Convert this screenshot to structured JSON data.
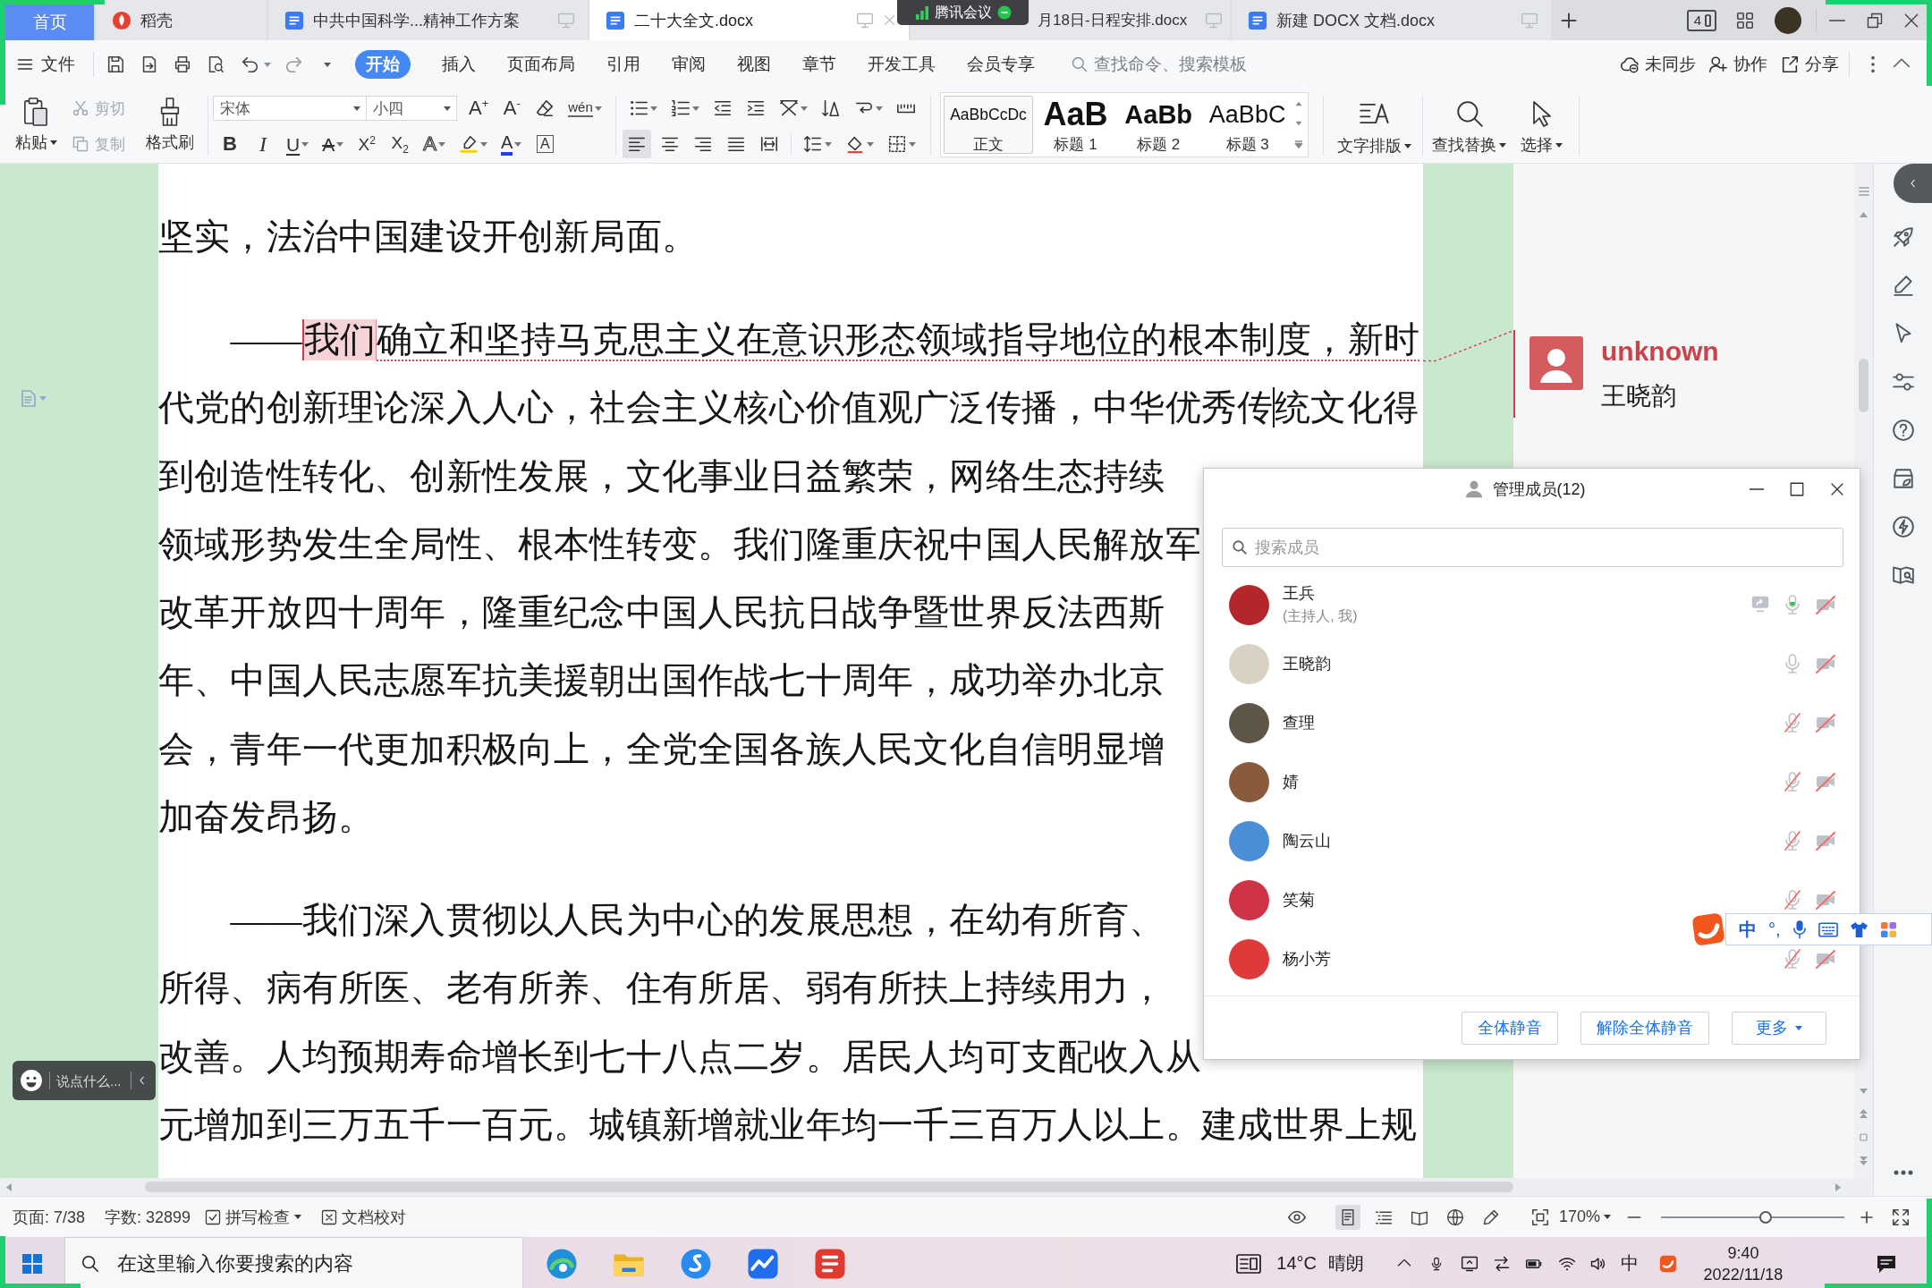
{
  "tabs": [
    {
      "label": "首页",
      "kind": "home",
      "selected": false
    },
    {
      "label": "稻壳",
      "kind": "docer",
      "selected": false
    },
    {
      "label": "中共中国科学...精神工作方案",
      "kind": "doc",
      "selected": false
    },
    {
      "label": "二十大全文.docx",
      "kind": "doc",
      "selected": true
    },
    {
      "label": "月18日-日程安排.docx",
      "kind": "covered",
      "selected": false
    },
    {
      "label": "新建 DOCX 文档.docx",
      "kind": "doc",
      "selected": false
    }
  ],
  "meeting_overlay": {
    "title": "腾讯会议"
  },
  "title_bar": {
    "count_badge": "4"
  },
  "menu": {
    "file": "文件",
    "items": [
      {
        "label": "开始",
        "selected": true
      },
      {
        "label": "插入",
        "selected": false
      },
      {
        "label": "页面布局",
        "selected": false
      },
      {
        "label": "引用",
        "selected": false
      },
      {
        "label": "审阅",
        "selected": false
      },
      {
        "label": "视图",
        "selected": false
      },
      {
        "label": "章节",
        "selected": false
      },
      {
        "label": "开发工具",
        "selected": false
      },
      {
        "label": "会员专享",
        "selected": false
      }
    ],
    "search_placeholder": "查找命令、搜索模板",
    "actions": [
      {
        "label": "未同步",
        "kind": "sync"
      },
      {
        "label": "协作",
        "kind": "collaborate"
      },
      {
        "label": "分享",
        "kind": "share"
      }
    ]
  },
  "ribbon": {
    "paste": "粘贴",
    "clipboard": [
      {
        "label": "剪切",
        "kind": "cut",
        "disabled": true
      },
      {
        "label": "复制",
        "kind": "copy",
        "disabled": true
      }
    ],
    "format_painter": "格式刷",
    "font": {
      "name": "宋体",
      "size": "小四"
    },
    "font_tools": [
      {
        "label": "A$^{+}$",
        "kind": "grow"
      },
      {
        "label": "A$^{-}$",
        "kind": "shrink"
      },
      {
        "kind": "eraser"
      },
      {
        "label": "wén",
        "kind": "pinyin"
      }
    ],
    "format_buttons": [
      {
        "label": "B",
        "kind": "bold"
      },
      {
        "label": "I",
        "kind": "italic"
      },
      {
        "label": "U",
        "kind": "underline"
      },
      {
        "label": "A",
        "kind": "strike"
      },
      {
        "label": "X$^{2}$",
        "kind": "sup"
      },
      {
        "label": "X$_{2}$",
        "kind": "sub"
      },
      {
        "label": "A",
        "kind": "effect"
      },
      {
        "kind": "highlight"
      },
      {
        "label": "A",
        "kind": "color"
      },
      {
        "label": "A",
        "kind": "border"
      }
    ],
    "alignment": [
      {
        "kind": "left",
        "selected": true
      },
      {
        "kind": "center",
        "selected": false
      },
      {
        "kind": "right",
        "selected": false
      },
      {
        "kind": "justify",
        "selected": false
      },
      {
        "kind": "distributed",
        "selected": false
      }
    ],
    "styles": [
      {
        "preview": "AaBbCcDc",
        "label": "正文",
        "kind": "normal",
        "selected": true
      },
      {
        "preview": "AaB",
        "label": "标题 1",
        "kind": "h1",
        "selected": false
      },
      {
        "preview": "AaBb",
        "label": "标题 2",
        "kind": "h2",
        "selected": false
      },
      {
        "preview": "AaBbC",
        "label": "标题 3",
        "kind": "h3",
        "selected": false
      }
    ],
    "tools": [
      {
        "label": "文字排版",
        "kind": "layout"
      },
      {
        "label": "查找替换",
        "kind": "find"
      },
      {
        "label": "选择",
        "kind": "select"
      }
    ]
  },
  "document": {
    "paragraphs": [
      {
        "continued": true,
        "lines": [
          {
            "kind": "plain",
            "parts": [
              "坚实，法治中国建设开创新局面。"
            ]
          }
        ]
      },
      {
        "continued": false,
        "lines": [
          {
            "kind": "comment",
            "parts": [
              "——",
              "我们",
              "确立和坚持马克思主义在意识形态领域指导地位的根本制度，新时"
            ]
          },
          {
            "kind": "caret",
            "parts": [
              "代党的创新理论深入人心，社会主义核心价值观广泛传播，中华优秀传",
              "统文化得"
            ]
          },
          {
            "kind": "plain",
            "parts": [
              "到创造性转化、创新性发展，文化事业日益繁荣，网络生态持续"
            ]
          },
          {
            "kind": "plain",
            "parts": [
              "领域形势发生全局性、根本性转变。我们隆重庆祝中国人民解放军"
            ]
          },
          {
            "kind": "plain",
            "parts": [
              "改革开放四十周年，隆重纪念中国人民抗日战争暨世界反法西斯"
            ]
          },
          {
            "kind": "plain",
            "parts": [
              "年、中国人民志愿军抗美援朝出国作战七十周年，成功举办北京"
            ]
          },
          {
            "kind": "plain",
            "parts": [
              "会，青年一代更加积极向上，全党全国各族人民文化自信明显增"
            ]
          },
          {
            "kind": "plain",
            "parts": [
              "加奋发昂扬。"
            ]
          }
        ]
      },
      {
        "continued": false,
        "lines": [
          {
            "kind": "plain",
            "parts": [
              "——我们深入贯彻以人民为中心的发展思想，在幼有所育、"
            ]
          },
          {
            "kind": "plain",
            "parts": [
              "所得、病有所医、老有所养、住有所居、弱有所扶上持续用力，"
            ]
          },
          {
            "kind": "plain",
            "parts": [
              "改善。人均预期寿命增长到七十八点二岁。居民人均可支配收入从"
            ]
          },
          {
            "kind": "plain",
            "parts": [
              "元增加到三万五千一百元。城镇新增就业年均一千三百万人以上。建成世界上规"
            ]
          }
        ]
      }
    ]
  },
  "comment": {
    "author": "unknown",
    "text": "王晓韵"
  },
  "members_dialog": {
    "title": "管理成员(12)",
    "search_placeholder": "搜索成员",
    "members": [
      {
        "name": "王兵",
        "role": "(主持人, 我)",
        "color": "#b3272b",
        "screen_share": true,
        "mic_on": true,
        "speaking": true,
        "camera_on": false
      },
      {
        "name": "王晓韵",
        "color": "#d9d2c4",
        "screen_share": false,
        "mic_on": true,
        "speaking": false,
        "camera_on": false
      },
      {
        "name": "查理",
        "color": "#5e5649",
        "screen_share": false,
        "mic_on": false,
        "speaking": false,
        "camera_on": false
      },
      {
        "name": "婧",
        "color": "#8a5a3c",
        "screen_share": false,
        "mic_on": false,
        "speaking": false,
        "camera_on": false
      },
      {
        "name": "陶云山",
        "color": "#4a8ed6",
        "screen_share": false,
        "mic_on": false,
        "speaking": false,
        "camera_on": false
      },
      {
        "name": "笑菊",
        "color": "#cf3347",
        "screen_share": false,
        "mic_on": false,
        "speaking": false,
        "camera_on": false
      },
      {
        "name": "杨小芳",
        "color": "#de3a3a",
        "screen_share": false,
        "mic_on": false,
        "speaking": false,
        "camera_on": false
      }
    ],
    "buttons": [
      {
        "label": "全体静音",
        "dropdown": false
      },
      {
        "label": "解除全体静音",
        "dropdown": false
      },
      {
        "label": "更多",
        "dropdown": true
      }
    ]
  },
  "ime_toolbar": {
    "mode": "中",
    "punctuation": "°,"
  },
  "chat_bar": {
    "placeholder": "说点什么..."
  },
  "status_bar": {
    "page": "页面: 7/38",
    "words": "字数: 32899",
    "spell_check": "拼写检查",
    "proofread": "文档校对",
    "views": [
      {
        "kind": "page",
        "selected": true
      },
      {
        "kind": "outline",
        "selected": false
      },
      {
        "kind": "read",
        "selected": false
      },
      {
        "kind": "web",
        "selected": false
      },
      {
        "kind": "write",
        "selected": false
      }
    ],
    "zoom": "170%",
    "zoom_slider": {
      "level": 0.57
    }
  },
  "taskbar": {
    "search_placeholder": "在这里输入你要搜索的内容",
    "temperature": "14°C",
    "weather": "晴朗",
    "ime": "中",
    "time": "9:40",
    "date": "2022/11/18"
  }
}
